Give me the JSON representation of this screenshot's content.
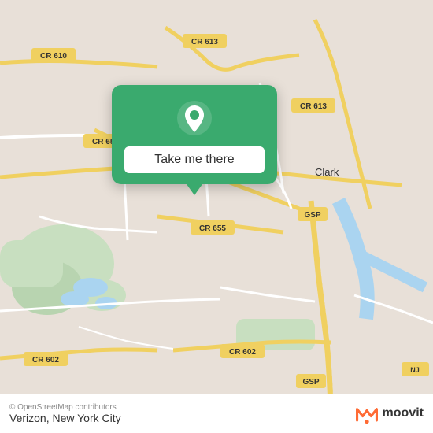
{
  "map": {
    "attribution": "© OpenStreetMap contributors",
    "bg_color": "#e8e0d8",
    "road_color": "#ffffff",
    "road_yellow": "#f0d060",
    "water_color": "#aad4f0",
    "green_color": "#c8dfc0"
  },
  "popup": {
    "button_label": "Take me there",
    "bg_color": "#3aaa6e",
    "pin_color": "#ffffff"
  },
  "bottom_bar": {
    "copyright": "© OpenStreetMap contributors",
    "location_name": "Verizon",
    "location_city": "New York City"
  },
  "labels": {
    "cr610": "CR 610",
    "cr613_top": "CR 613",
    "cr655_left": "CR 655",
    "cr655_bottom": "CR 655",
    "cr613_right": "CR 613",
    "cr602_left": "CR 602",
    "cr602_right": "CR 602",
    "gsp_right": "GSP",
    "gsp_bottom": "GSP",
    "clark": "Clark"
  },
  "moovit": {
    "text": "moovit",
    "icon_color": "#ff6b35"
  }
}
